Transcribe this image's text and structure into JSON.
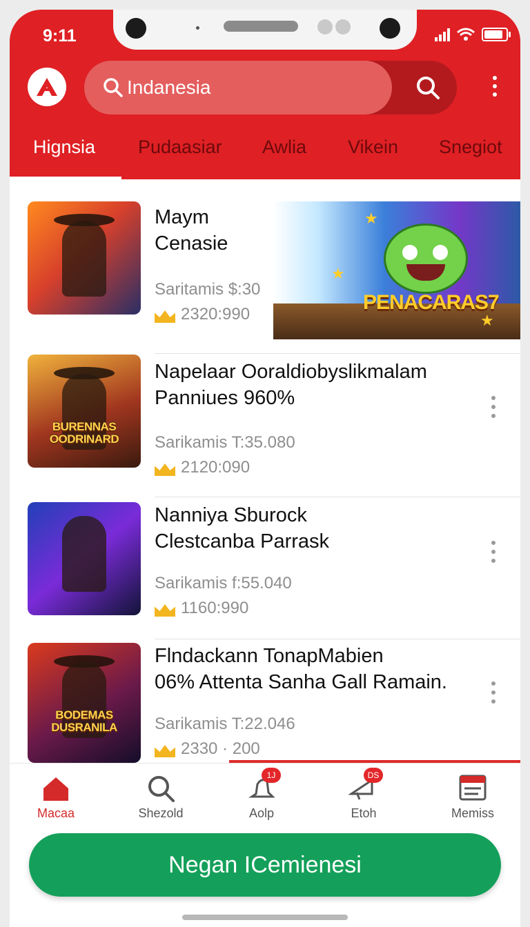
{
  "status_bar": {
    "time": "9:11"
  },
  "header": {
    "search_value": "Indanesia",
    "tabs": [
      {
        "label": "Hignsia"
      },
      {
        "label": "Pudaasiar"
      },
      {
        "label": "Awlia"
      },
      {
        "label": "Vikein"
      },
      {
        "label": "Snegiot"
      }
    ]
  },
  "games": [
    {
      "title_line1": "Maym",
      "title_line2": "Cenasie",
      "meta": "Saritamis $:30",
      "score": "2320:990",
      "thumb_text": "",
      "banner_title": "PENACARAS7"
    },
    {
      "title_line1": "Napelaar Ooraldiobyslikmalam",
      "title_line2": "Panniues 960%",
      "meta": "Sarikamis T:35.080",
      "score": "2120:090",
      "thumb_text": "BURENNAS OODRINARD"
    },
    {
      "title_line1": "Nanniya Sburock",
      "title_line2": "Clestcanba Parrask",
      "meta": "Sarikamis f:55.040",
      "score": "1160:990",
      "thumb_text": ""
    },
    {
      "title_line1": "Flndackann TonapMabien",
      "title_line2": "06% Attenta Sanha Gall Ramain.",
      "meta": "Sarikamis T:22.046",
      "score": "2330 · 200",
      "thumb_text": "BODEMAS DUSRANILA"
    }
  ],
  "bottom_nav": [
    {
      "label": "Macaa",
      "icon": "home-icon",
      "badge": ""
    },
    {
      "label": "Shezold",
      "icon": "search-icon",
      "badge": ""
    },
    {
      "label": "Aolp",
      "icon": "bell-icon",
      "badge": "1J"
    },
    {
      "label": "Etoh",
      "icon": "megaphone-icon",
      "badge": "DS"
    },
    {
      "label": "Memiss",
      "icon": "news-icon",
      "badge": ""
    }
  ],
  "cta_label": "Negan ICemienesi",
  "colors": {
    "brand_red": "#df2024",
    "cta_green": "#14a05a",
    "star_gold": "#f2b51f"
  }
}
